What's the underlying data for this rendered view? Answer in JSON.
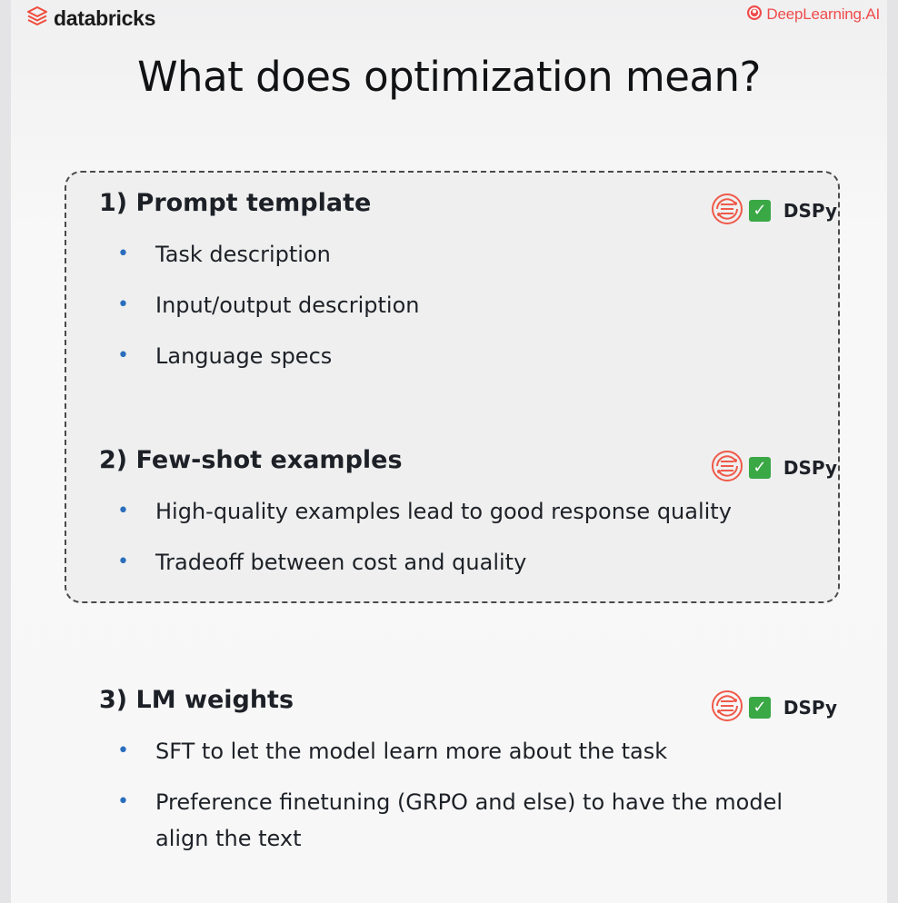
{
  "header": {
    "databricks_logo_text": "databricks",
    "deeplearning_logo_text": "DeepLearning.AI"
  },
  "title": "What does optimization mean?",
  "sections": [
    {
      "heading": "1) Prompt template",
      "badge_label": "DSPy",
      "bullets": [
        "Task description",
        "Input/output description",
        "Language specs"
      ]
    },
    {
      "heading": "2) Few-shot examples",
      "badge_label": "DSPy",
      "bullets": [
        "High-quality examples lead to good response quality",
        "Tradeoff between cost and quality"
      ]
    },
    {
      "heading": "3) LM weights",
      "badge_label": "DSPy",
      "bullets": [
        "SFT to let the model learn more about the task",
        "Preference finetuning (GRPO and else) to have the model align the text"
      ]
    }
  ],
  "icons": {
    "databricks": "databricks-layers-icon",
    "deeplearning": "deeplearning-ai-icon",
    "dspy": "dspy-icon",
    "check": "check-icon"
  },
  "colors": {
    "dspy_accent": "#ef5a4a",
    "check_green": "#3aa845",
    "dlai_red": "#ef4b4b",
    "databricks_red": "#ef4b3a",
    "bullet_blue": "#2a6ebd"
  }
}
